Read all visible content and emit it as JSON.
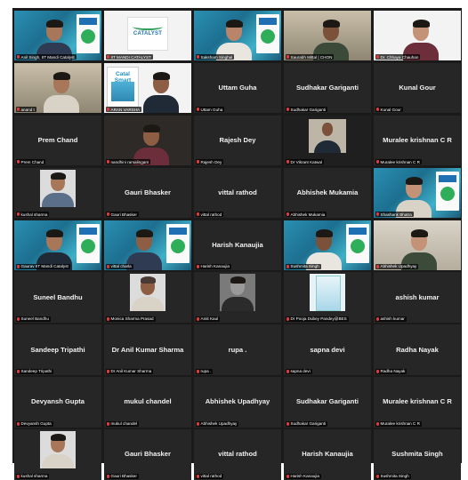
{
  "meeting": {
    "tiles": [
      {
        "label": "Anil Singh, IIT Mandi Catalyst",
        "center": "",
        "kind": "video",
        "scene": "blue-banner-person",
        "icon": "mic-muted-icon"
      },
      {
        "label": "IIT MANDI CATALYST",
        "center": "",
        "kind": "video",
        "scene": "catalyst-logo",
        "icon": "mic-muted-icon"
      },
      {
        "label": "Saksham Singhal",
        "center": "",
        "kind": "video",
        "scene": "blue-banner-person",
        "icon": "mic-muted-icon"
      },
      {
        "label": "Saurabh Mittal | CHON",
        "center": "",
        "kind": "video",
        "scene": "room-person",
        "icon": "mic-muted-icon"
      },
      {
        "label": "Dr. Chhaya Chauhan",
        "center": "",
        "kind": "video",
        "scene": "white-person",
        "icon": "mic-muted-icon"
      },
      {
        "label": "anand t",
        "center": "",
        "kind": "video",
        "scene": "room-person",
        "icon": "mic-muted-icon"
      },
      {
        "label": "ARAN VARSHA",
        "center": "",
        "kind": "video",
        "scene": "poster-person",
        "icon": "mic-muted-icon",
        "poster_text": "Catal Smart"
      },
      {
        "label": "Uttam Guha",
        "center": "Uttam Guha",
        "kind": "name",
        "icon": "mic-muted-icon"
      },
      {
        "label": "Sudhakar Gariganti",
        "center": "Sudhakar Gariganti",
        "kind": "name",
        "icon": "mic-muted-icon"
      },
      {
        "label": "Kunal Gour",
        "center": "Kunal Gour",
        "kind": "name",
        "icon": "mic-muted-icon"
      },
      {
        "label": "Prem Chand",
        "center": "Prem Chand",
        "kind": "name",
        "icon": "mic-muted-icon"
      },
      {
        "label": "nandhini ramalingam",
        "center": "",
        "kind": "video",
        "scene": "dark-person",
        "icon": "mic-muted-icon"
      },
      {
        "label": "Rajesh Dey",
        "center": "Rajesh Dey",
        "kind": "name",
        "icon": "mic-muted-icon"
      },
      {
        "label": "Dr Vikrant Katwal",
        "center": "",
        "kind": "video",
        "scene": "small-person",
        "icon": "mic-muted-icon"
      },
      {
        "label": "Muralee krishnan C R",
        "center": "Muralee krishnan C R",
        "kind": "name",
        "icon": "mic-muted-icon"
      },
      {
        "label": "kushal sharma",
        "center": "",
        "kind": "video",
        "scene": "avatar-photo",
        "icon": "mic-muted-icon"
      },
      {
        "label": "Gauri Bhasker",
        "center": "Gauri Bhasker",
        "kind": "name",
        "icon": "mic-muted-icon"
      },
      {
        "label": "vittal rathod",
        "center": "vittal rathod",
        "kind": "name",
        "icon": "mic-muted-icon"
      },
      {
        "label": "Abhishek Mukamia",
        "center": "Abhishek Mukamia",
        "kind": "name",
        "icon": "mic-muted-icon"
      },
      {
        "label": "Shashank Bhatra",
        "center": "",
        "kind": "video",
        "scene": "blue-banner-person",
        "icon": "mic-muted-icon"
      },
      {
        "label": "Gaurav IIT Mandi Catalyst",
        "center": "",
        "kind": "video",
        "scene": "blue-banner-person",
        "icon": "mic-muted-icon"
      },
      {
        "label": "vittal charla",
        "center": "",
        "kind": "video",
        "scene": "blue-banner-person",
        "icon": "mic-muted-icon"
      },
      {
        "label": "Harish Kanaujia",
        "center": "Harish Kanaujia",
        "kind": "name",
        "icon": "mic-muted-icon"
      },
      {
        "label": "Sushmita Singh",
        "center": "",
        "kind": "video",
        "scene": "blue-banner-person",
        "icon": "mic-muted-icon"
      },
      {
        "label": "Abhishek Upadhyay",
        "center": "",
        "kind": "video",
        "scene": "office-person",
        "icon": "mic-muted-icon"
      },
      {
        "label": "Suneel Bandhu",
        "center": "Suneel Bandhu",
        "kind": "name",
        "icon": "mic-muted-icon"
      },
      {
        "label": "Monica Sharma Prasad",
        "center": "",
        "kind": "video",
        "scene": "avatar-woman",
        "icon": "mic-muted-icon"
      },
      {
        "label": "Amit Kaul",
        "center": "",
        "kind": "video",
        "scene": "avatar-grey",
        "icon": "mic-muted-icon"
      },
      {
        "label": "Dr Pooja Dubey Pandey@BES",
        "center": "",
        "kind": "video",
        "scene": "avatar-poster",
        "icon": "mic-muted-icon"
      },
      {
        "label": "ashish kumar",
        "center": "ashish kumar",
        "kind": "name",
        "icon": "mic-muted-icon"
      },
      {
        "label": "Sandeep Tripathi",
        "center": "Sandeep Tripathi",
        "kind": "name",
        "icon": "mic-muted-icon"
      },
      {
        "label": "Dr Anil Kumar Sharma",
        "center": "Dr Anil Kumar Sharma",
        "kind": "name",
        "icon": "mic-muted-icon"
      },
      {
        "label": "rupa .",
        "center": "rupa .",
        "kind": "name",
        "icon": "mic-muted-icon"
      },
      {
        "label": "sapna devi",
        "center": "sapna devi",
        "kind": "name",
        "icon": "mic-muted-icon"
      },
      {
        "label": "Radha Nayak",
        "center": "Radha Nayak",
        "kind": "name",
        "icon": "mic-muted-icon"
      },
      {
        "label": "Devyansh Gupta",
        "center": "Devyansh Gupta",
        "kind": "name",
        "icon": "mic-muted-icon"
      },
      {
        "label": "mukul chandel",
        "center": "mukul chandel",
        "kind": "name",
        "icon": "mic-muted-icon"
      },
      {
        "label": "Abhishek Upadhyay",
        "center": "Abhishek Upadhyay",
        "kind": "name",
        "icon": "mic-muted-icon"
      },
      {
        "label": "Sudhakar Gariganti",
        "center": "Sudhakar Gariganti",
        "kind": "name",
        "icon": "mic-muted-icon"
      },
      {
        "label": "Muralee krishnan C R",
        "center": "Muralee krishnan C R",
        "kind": "name",
        "icon": "mic-muted-icon"
      },
      {
        "label": "kushal sharma",
        "center": "",
        "kind": "video",
        "scene": "avatar-photo",
        "icon": "mic-muted-icon"
      },
      {
        "label": "Gauri Bhasker",
        "center": "Gauri Bhasker",
        "kind": "name",
        "icon": "mic-muted-icon"
      },
      {
        "label": "vittal rathod",
        "center": "vittal rathod",
        "kind": "name",
        "icon": "mic-muted-icon"
      },
      {
        "label": "Harish Kanaujia",
        "center": "Harish Kanaujia",
        "kind": "name",
        "icon": "mic-muted-icon"
      },
      {
        "label": "Sushmita Singh",
        "center": "Sushmita Singh",
        "kind": "name",
        "icon": "mic-muted-icon"
      }
    ],
    "catalyst_logo_text": "CATALYST",
    "colors": {
      "gallery_bg": "#1a1a1a",
      "tile_bg": "#262626",
      "muted_mic": "#e03a3a",
      "banner_blue": "#1f6fb5",
      "banner_green": "#2fae5a"
    }
  }
}
